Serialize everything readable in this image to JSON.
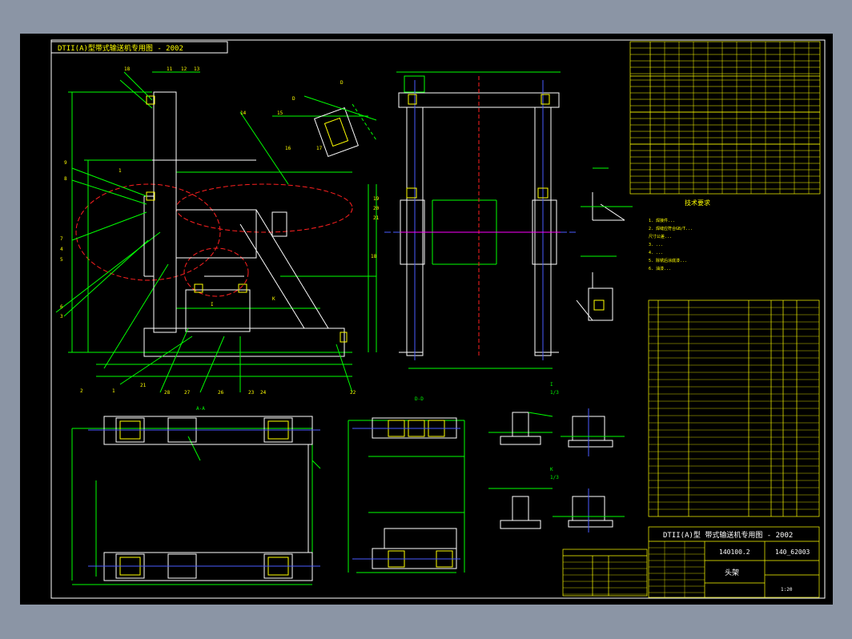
{
  "drawing": {
    "header_title": "DTII(A)型带式输送机专用图 - 2002",
    "title_block_title": "DTII(A)型 带式输送机专用图 - 2002",
    "drawing_number": "140100.2",
    "drawing_code": "140_62003",
    "part_name": "头架",
    "scale_note": "1:20"
  },
  "views": {
    "section_aa": "A-A",
    "section_dd": "D-D",
    "detail_k": "K",
    "detail_k_scale": "1/3",
    "detail_i": "I",
    "detail_i_scale": "1/3"
  },
  "tech_requirements": {
    "heading": "技术要求",
    "lines": [
      "1. 焊接件...",
      "2. 焊缝应符合GB/T...",
      "   尺寸公差...",
      "3. ...",
      "4. ...",
      "5. 除锈后涂底漆...",
      "6. 油漆..."
    ]
  },
  "colors": {
    "background": "#000000",
    "frame": "#ffffff",
    "outline": "#ffffff",
    "dimension": "#00ff00",
    "center": "#4a5cff",
    "hidden": "#ff2020",
    "section": "#ffff00",
    "aux": "#ff00ff",
    "table": "#ffff00",
    "table_text": "#ff6060"
  }
}
